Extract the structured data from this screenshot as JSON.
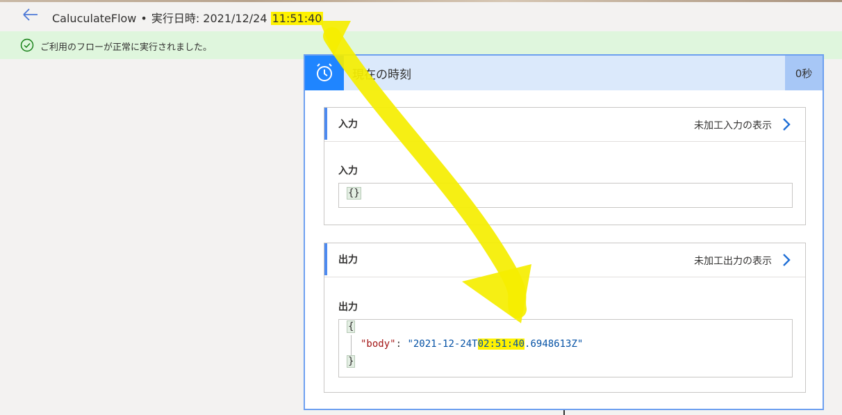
{
  "header": {
    "flow_name": "CaluculateFlow",
    "separator": "•",
    "run_label": "実行日時: 2021/12/24",
    "run_time": "11:51:40"
  },
  "banner": {
    "message": "ご利用のフローが正常に実行されました。"
  },
  "action": {
    "title": "現在の時刻",
    "duration": "0秒",
    "inputs": {
      "section_label": "入力",
      "raw_link": "未加工入力の表示",
      "sub_label": "入力",
      "code": "{}"
    },
    "outputs": {
      "section_label": "出力",
      "raw_link": "未加工出力の表示",
      "sub_label": "出力",
      "open_brace": "{",
      "close_brace": "}",
      "key": "\"body\"",
      "colon": ": ",
      "value_prefix": "\"2021-12-24T",
      "value_highlight": "02:51:40",
      "value_suffix": ".6948613Z\""
    }
  },
  "colors": {
    "accent": "#1f85ff",
    "highlight": "#fff200",
    "success_banner": "#dff6dd"
  },
  "icons": [
    "back-arrow-icon",
    "check-circle-icon",
    "alarm-clock-icon",
    "chevron-right-icon"
  ]
}
